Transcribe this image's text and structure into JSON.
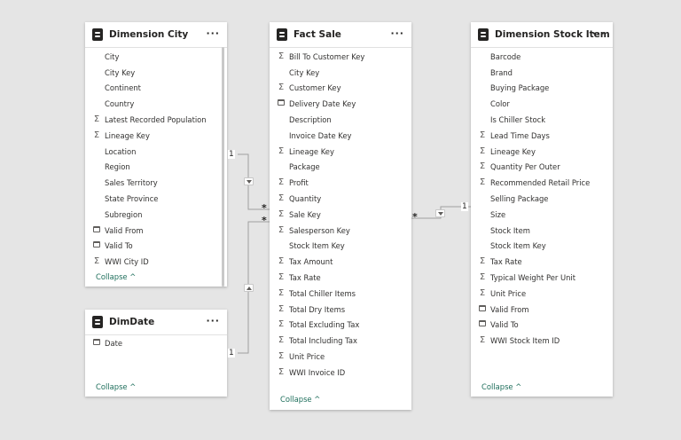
{
  "tables": {
    "city": {
      "title": "Dimension City",
      "more": "···",
      "collapse": "Collapse ^",
      "fields": [
        {
          "icon": "none",
          "name": "City"
        },
        {
          "icon": "none",
          "name": "City Key"
        },
        {
          "icon": "none",
          "name": "Continent"
        },
        {
          "icon": "none",
          "name": "Country"
        },
        {
          "icon": "sigma",
          "name": "Latest Recorded Population"
        },
        {
          "icon": "sigma",
          "name": "Lineage Key"
        },
        {
          "icon": "none",
          "name": "Location"
        },
        {
          "icon": "none",
          "name": "Region"
        },
        {
          "icon": "none",
          "name": "Sales Territory"
        },
        {
          "icon": "none",
          "name": "State Province"
        },
        {
          "icon": "none",
          "name": "Subregion"
        },
        {
          "icon": "calendar",
          "name": "Valid From"
        },
        {
          "icon": "calendar",
          "name": "Valid To"
        },
        {
          "icon": "sigma",
          "name": "WWI City ID"
        }
      ]
    },
    "date": {
      "title": "DimDate",
      "more": "···",
      "collapse": "Collapse ^",
      "fields": [
        {
          "icon": "calendar",
          "name": "Date"
        }
      ]
    },
    "sale": {
      "title": "Fact Sale",
      "more": "···",
      "collapse": "Collapse ^",
      "fields": [
        {
          "icon": "sigma",
          "name": "Bill To Customer Key"
        },
        {
          "icon": "none",
          "name": "City Key"
        },
        {
          "icon": "sigma",
          "name": "Customer Key"
        },
        {
          "icon": "calendar",
          "name": "Delivery Date Key"
        },
        {
          "icon": "none",
          "name": "Description"
        },
        {
          "icon": "none",
          "name": "Invoice Date Key"
        },
        {
          "icon": "sigma",
          "name": "Lineage Key"
        },
        {
          "icon": "none",
          "name": "Package"
        },
        {
          "icon": "sigma",
          "name": "Profit"
        },
        {
          "icon": "sigma",
          "name": "Quantity"
        },
        {
          "icon": "sigma",
          "name": "Sale Key"
        },
        {
          "icon": "sigma",
          "name": "Salesperson Key"
        },
        {
          "icon": "none",
          "name": "Stock Item Key"
        },
        {
          "icon": "sigma",
          "name": "Tax Amount"
        },
        {
          "icon": "sigma",
          "name": "Tax Rate"
        },
        {
          "icon": "sigma",
          "name": "Total Chiller Items"
        },
        {
          "icon": "sigma",
          "name": "Total Dry Items"
        },
        {
          "icon": "sigma",
          "name": "Total Excluding Tax"
        },
        {
          "icon": "sigma",
          "name": "Total Including Tax"
        },
        {
          "icon": "sigma",
          "name": "Unit Price"
        },
        {
          "icon": "sigma",
          "name": "WWI Invoice ID"
        }
      ]
    },
    "stock": {
      "title": "Dimension Stock Item",
      "more": "···",
      "collapse": "Collapse ^",
      "fields": [
        {
          "icon": "none",
          "name": "Barcode"
        },
        {
          "icon": "none",
          "name": "Brand"
        },
        {
          "icon": "none",
          "name": "Buying Package"
        },
        {
          "icon": "none",
          "name": "Color"
        },
        {
          "icon": "none",
          "name": "Is Chiller Stock"
        },
        {
          "icon": "sigma",
          "name": "Lead Time Days"
        },
        {
          "icon": "sigma",
          "name": "Lineage Key"
        },
        {
          "icon": "sigma",
          "name": "Quantity Per Outer"
        },
        {
          "icon": "sigma",
          "name": "Recommended Retail Price"
        },
        {
          "icon": "none",
          "name": "Selling Package"
        },
        {
          "icon": "none",
          "name": "Size"
        },
        {
          "icon": "none",
          "name": "Stock Item"
        },
        {
          "icon": "none",
          "name": "Stock Item Key"
        },
        {
          "icon": "sigma",
          "name": "Tax Rate"
        },
        {
          "icon": "sigma",
          "name": "Typical Weight Per Unit"
        },
        {
          "icon": "sigma",
          "name": "Unit Price"
        },
        {
          "icon": "calendar",
          "name": "Valid From"
        },
        {
          "icon": "calendar",
          "name": "Valid To"
        },
        {
          "icon": "sigma",
          "name": "WWI Stock Item ID"
        }
      ]
    }
  },
  "relationships": {
    "city_sale": {
      "from_card": "1",
      "to_card": "*"
    },
    "date_sale": {
      "from_card": "1",
      "to_card": "*"
    },
    "stock_sale": {
      "from_card": "1",
      "to_card": "*"
    }
  },
  "icons": {
    "sigma": "sigma-icon",
    "calendar": "calendar-icon",
    "table": "table-icon"
  }
}
